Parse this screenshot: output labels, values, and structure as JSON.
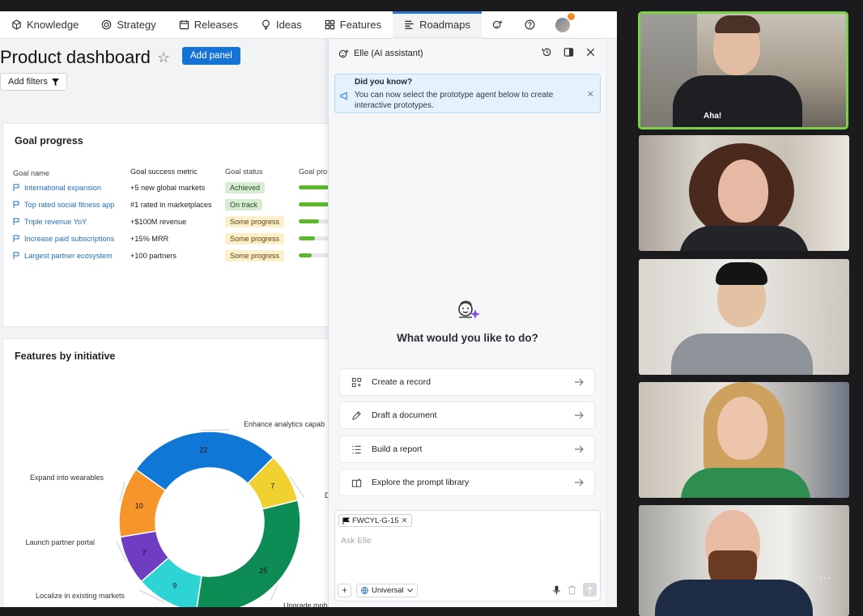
{
  "nav": {
    "items": [
      {
        "label": "Knowledge",
        "icon": "knowledge-icon"
      },
      {
        "label": "Strategy",
        "icon": "target-icon"
      },
      {
        "label": "Releases",
        "icon": "calendar-icon"
      },
      {
        "label": "Ideas",
        "icon": "lightbulb-icon"
      },
      {
        "label": "Features",
        "icon": "grid-icon"
      },
      {
        "label": "Roadmaps",
        "icon": "roadmap-icon",
        "active": true
      }
    ],
    "accent": "#2a77d3"
  },
  "page": {
    "title": "Product dashboard",
    "add_panel": "Add panel",
    "add_filters": "Add filters"
  },
  "goals": {
    "title": "Goal progress",
    "headers": [
      "Goal name",
      "Goal success metric",
      "Goal status",
      "Goal pro"
    ],
    "rows": [
      {
        "name": "International expansion",
        "metric": "+5 new global markets",
        "status": "Achieved",
        "status_color": "green",
        "progress": 0.9
      },
      {
        "name": "Top rated social fitness app",
        "metric": "#1 rated in marketplaces",
        "status": "On track",
        "status_color": "green",
        "progress": 0.85
      },
      {
        "name": "Triple revenue YoY",
        "metric": "+$100M revenue",
        "status": "Some progress",
        "status_color": "yellow",
        "progress": 0.5
      },
      {
        "name": "Increase paid subscriptions",
        "metric": "+15% MRR",
        "status": "Some progress",
        "status_color": "yellow",
        "progress": 0.4
      },
      {
        "name": "Largest partner ecosystem",
        "metric": "+100 partners",
        "status": "Some progress",
        "status_color": "yellow",
        "progress": 0.32
      }
    ]
  },
  "initiatives": {
    "title": "Features by initiative"
  },
  "chart_data": {
    "type": "pie",
    "title": "Features by initiative",
    "categories": [
      "Enhance analytics capab",
      "D",
      "Upgrade mob",
      "Localize in existing markets",
      "Launch partner portal",
      "Expand into wearables"
    ],
    "values": [
      22,
      7,
      25,
      9,
      7,
      10
    ],
    "colors": [
      "#0f77d6",
      "#efd131",
      "#0d8c55",
      "#2ed3d4",
      "#6f3dc1",
      "#f6952a"
    ]
  },
  "assistant": {
    "title": "Elle (AI assistant)",
    "tip_title": "Did you know?",
    "tip_body": "You can now select the prototype agent below to create interactive prototypes.",
    "question": "What would you like to do?",
    "actions": [
      {
        "label": "Create a record",
        "icon": "record-icon"
      },
      {
        "label": "Draft a document",
        "icon": "pen-icon"
      },
      {
        "label": "Build a report",
        "icon": "report-icon"
      },
      {
        "label": "Explore the prompt library",
        "icon": "library-icon"
      }
    ],
    "chip": "FWCYL-G-15",
    "placeholder": "Ask Elle",
    "scope": "Universal"
  },
  "video": {
    "logo_text": "Aha!",
    "more": "..."
  }
}
